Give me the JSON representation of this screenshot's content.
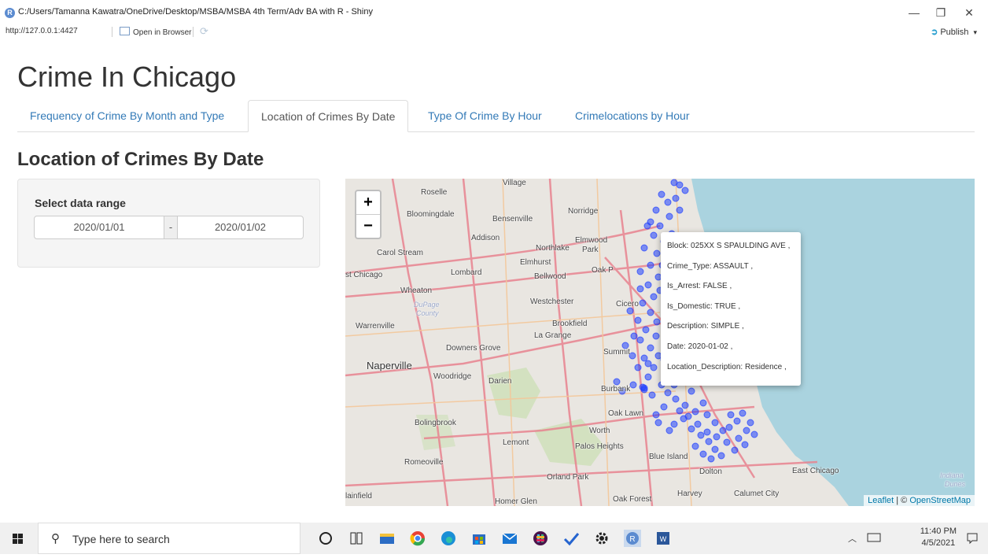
{
  "window": {
    "title": "C:/Users/Tamanna Kawatra/OneDrive/Desktop/MSBA/MSBA 4th Term/Adv BA with R - Shiny",
    "minimize": "—",
    "restore": "❐",
    "close": "✕"
  },
  "toolbar": {
    "url": "http://127.0.0.1:4427",
    "open_in_browser": "Open in Browser",
    "publish": "Publish",
    "publish_caret": "▾"
  },
  "app": {
    "title": "Crime In Chicago",
    "tabs": [
      {
        "label": "Frequency of Crime By Month and Type",
        "active": false
      },
      {
        "label": "Location of Crimes By Date",
        "active": true
      },
      {
        "label": "Type Of Crime By Hour",
        "active": false
      },
      {
        "label": "Crimelocations by Hour",
        "active": false
      }
    ],
    "section_title": "Location of Crimes By Date",
    "sidebar": {
      "label": "Select data range",
      "date_from": "2020/01/01",
      "date_sep": "-",
      "date_to": "2020/01/02"
    }
  },
  "map": {
    "zoom_in": "+",
    "zoom_out": "−",
    "place_labels": [
      {
        "text": "Village"
      },
      {
        "text": "Roselle"
      },
      {
        "text": "Bloomingdale"
      },
      {
        "text": "Bensenville"
      },
      {
        "text": "Norridge"
      },
      {
        "text": "Addison"
      },
      {
        "text": "Elmwood"
      },
      {
        "text": "Park"
      },
      {
        "text": "Northlake"
      },
      {
        "text": "Carol Stream"
      },
      {
        "text": "Elmhurst"
      },
      {
        "text": "Oak P"
      },
      {
        "text": "st Chicago"
      },
      {
        "text": "Lombard"
      },
      {
        "text": "Bellwood"
      },
      {
        "text": "Wheaton"
      },
      {
        "text": "Westchester"
      },
      {
        "text": "Cicero"
      },
      {
        "text": "Brookfield"
      },
      {
        "text": "Warrenville"
      },
      {
        "text": "La Grange"
      },
      {
        "text": "Downers Grove"
      },
      {
        "text": "Summit"
      },
      {
        "text": "Naperville"
      },
      {
        "text": "Woodridge"
      },
      {
        "text": "Darien"
      },
      {
        "text": "Burbank"
      },
      {
        "text": "Oak Lawn"
      },
      {
        "text": "Bolingbrook"
      },
      {
        "text": "Worth"
      },
      {
        "text": "Lemont"
      },
      {
        "text": "Palos Heights"
      },
      {
        "text": "Blue Island"
      },
      {
        "text": "Romeoville"
      },
      {
        "text": "Dolton"
      },
      {
        "text": "East Chicago"
      },
      {
        "text": "Orland Park"
      },
      {
        "text": "Harvey"
      },
      {
        "text": "Calumet City"
      },
      {
        "text": "lainfield"
      },
      {
        "text": "Homer Glen"
      },
      {
        "text": "Oak Forest"
      }
    ],
    "county_labels": [
      "DuPage",
      "County",
      "Indiana",
      "Dunes"
    ],
    "popup": {
      "lines": [
        "Block: 025XX S SPAULDING AVE ,",
        "Crime_Type: ASSAULT ,",
        "Is_Arrest: FALSE ,",
        "Is_Domestic: TRUE ,",
        "Description: SIMPLE ,",
        "Date: 2020-01-02 ,",
        "Location_Description: Residence ,"
      ]
    },
    "attribution": {
      "leaflet": "Leaflet",
      "sep": " | © ",
      "osm": "OpenStreetMap"
    },
    "colors": {
      "marker": "#1f3fff",
      "water": "#aad3df",
      "land": "#e9e6e1",
      "highway": "#e8838f"
    }
  },
  "taskbar": {
    "search_placeholder": "Type here to search",
    "time": "11:40 PM",
    "date": "4/5/2021",
    "icons": [
      "windows-start-icon",
      "cortana-icon",
      "task-view-icon",
      "file-explorer-icon",
      "chrome-icon",
      "edge-icon",
      "store-icon",
      "mail-icon",
      "slack-icon",
      "todo-icon",
      "settings-icon",
      "r-icon",
      "word-icon"
    ]
  }
}
